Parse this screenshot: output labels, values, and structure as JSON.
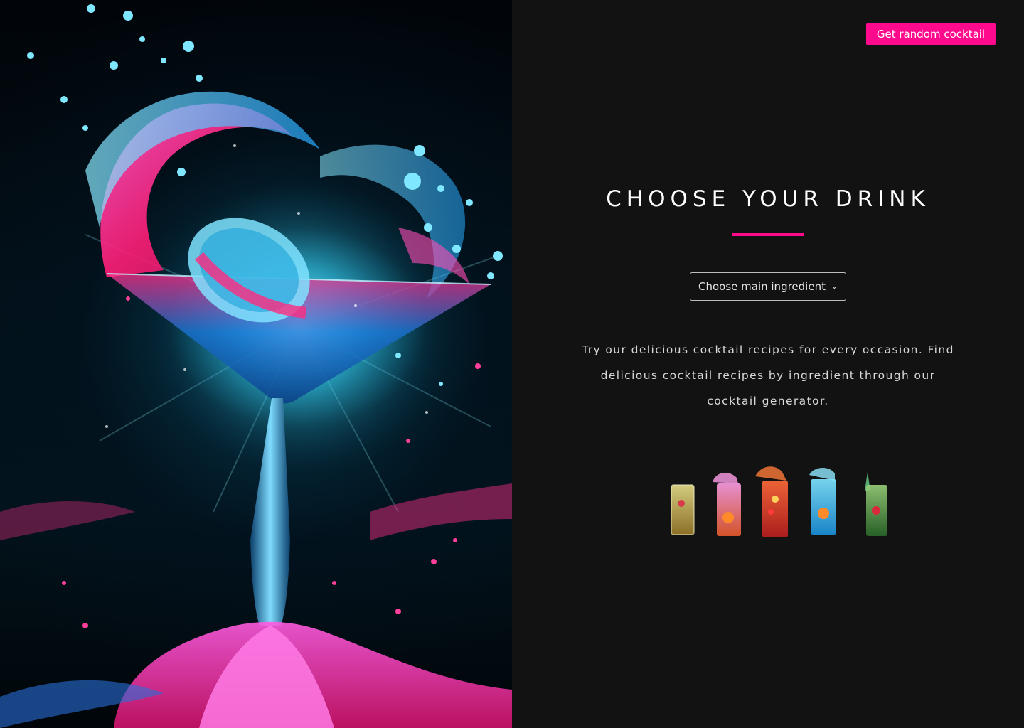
{
  "header": {
    "random_button_label": "Get random cocktail"
  },
  "main": {
    "title": "CHOOSE YOUR DRINK",
    "ingredient_select": {
      "selected": "Choose main ingredient"
    },
    "description": "Try our delicious cocktail recipes for every occasion. Find delicious cocktail recipes by ingredient through our cocktail generator."
  },
  "colors": {
    "accent": "#ff0a8c",
    "background": "#121212",
    "text": "#ffffff"
  },
  "images": {
    "hero": "martini-glass-splash-image",
    "drinks": [
      "yellow-cocktail-glass",
      "pink-cocktail-glass",
      "red-cocktail-glass",
      "blue-cocktail-glass",
      "green-cocktail-glass"
    ]
  }
}
